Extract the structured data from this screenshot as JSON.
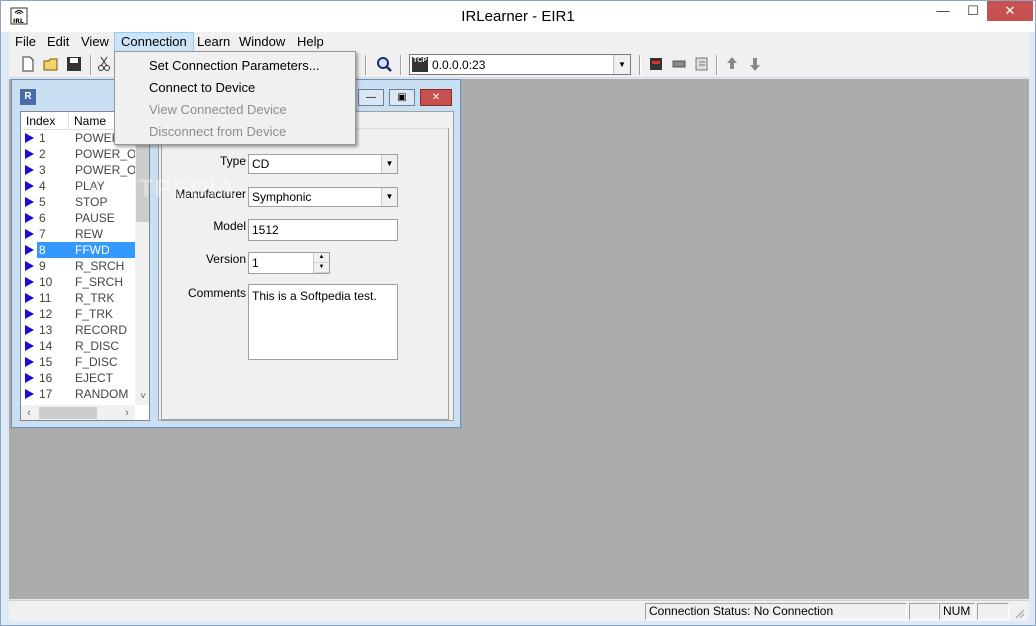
{
  "window": {
    "title": "IRLearner - EIR1",
    "app_icon": "IRL",
    "minimize": "—",
    "maximize": "☐",
    "close": "✕"
  },
  "menubar": [
    {
      "label": "File"
    },
    {
      "label": "Edit"
    },
    {
      "label": "View"
    },
    {
      "label": "Connection"
    },
    {
      "label": "Learn"
    },
    {
      "label": "Window"
    },
    {
      "label": "Help"
    }
  ],
  "toolbar": {
    "address": "0.0.0.0:23",
    "address_icon_label": "TCP",
    "buttons": [
      "new-icon",
      "open-icon",
      "save-icon",
      "cut-icon",
      "find-icon",
      "device-icon",
      "learn-icon",
      "edit-icon",
      "upload-icon",
      "download-icon"
    ]
  },
  "connection_menu": {
    "items": [
      {
        "label": "Set Connection Parameters...",
        "enabled": true
      },
      {
        "label": "Connect to Device",
        "enabled": true
      },
      {
        "label": "View Connected Device",
        "enabled": false
      },
      {
        "label": "Disconnect from Device",
        "enabled": false
      }
    ]
  },
  "child_window": {
    "icon_label": "R",
    "list": {
      "headers": [
        "Index",
        "Name"
      ],
      "rows": [
        {
          "index": "1",
          "name": "POWER"
        },
        {
          "index": "2",
          "name": "POWER_ON"
        },
        {
          "index": "3",
          "name": "POWER_OFF"
        },
        {
          "index": "4",
          "name": "PLAY"
        },
        {
          "index": "5",
          "name": "STOP"
        },
        {
          "index": "6",
          "name": "PAUSE"
        },
        {
          "index": "7",
          "name": "REW"
        },
        {
          "index": "8",
          "name": "FFWD"
        },
        {
          "index": "9",
          "name": "R_SRCH"
        },
        {
          "index": "10",
          "name": "F_SRCH"
        },
        {
          "index": "11",
          "name": "R_TRK"
        },
        {
          "index": "12",
          "name": "F_TRK"
        },
        {
          "index": "13",
          "name": "RECORD"
        },
        {
          "index": "14",
          "name": "R_DISC"
        },
        {
          "index": "15",
          "name": "F_DISC"
        },
        {
          "index": "16",
          "name": "EJECT"
        },
        {
          "index": "17",
          "name": "RANDOM"
        }
      ],
      "selected_index": "8"
    },
    "form": {
      "type_label": "Type",
      "type_value": "CD",
      "manufacturer_label": "Manufacturer",
      "manufacturer_value": "Symphonic",
      "model_label": "Model",
      "model_value": "1512",
      "version_label": "Version",
      "version_value": "1",
      "comments_label": "Comments",
      "comments_value": "This is a Softpedia test."
    }
  },
  "statusbar": {
    "connection_status": "Connection Status: No Connection",
    "num": "NUM"
  },
  "watermark": "SOFTPEDIA"
}
